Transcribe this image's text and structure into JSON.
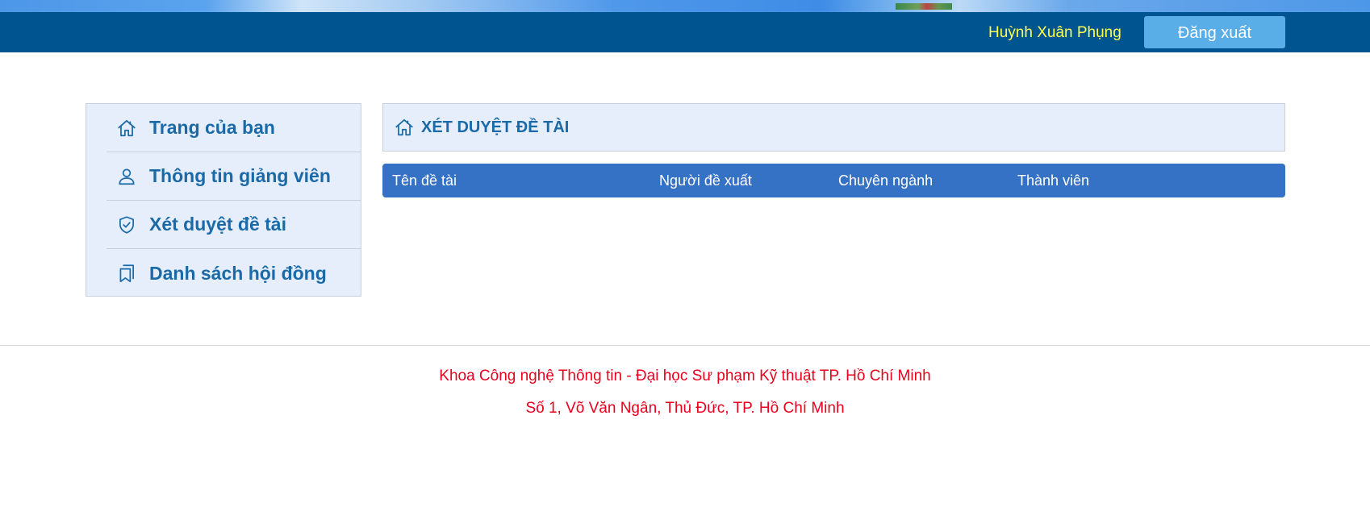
{
  "header": {
    "user_name": "Huỳnh Xuân Phụng",
    "logout_label": "Đăng xuất"
  },
  "sidebar": {
    "items": [
      {
        "label": "Trang của bạn",
        "icon": "home-icon"
      },
      {
        "label": "Thông tin giảng viên",
        "icon": "user-icon"
      },
      {
        "label": "Xét duyệt đề tài",
        "icon": "shield-check-icon"
      },
      {
        "label": "Danh sách hội đồng",
        "icon": "bookmarks-icon"
      }
    ]
  },
  "main": {
    "title": "XÉT DUYỆT ĐỀ TÀI",
    "title_icon": "home-icon",
    "table": {
      "columns": [
        "Tên đề tài",
        "Người đề xuất",
        "Chuyên ngành",
        "Thành viên"
      ],
      "rows": []
    }
  },
  "footer": {
    "line1": "Khoa Công nghệ Thông tin - Đại học Sư phạm Kỹ thuật TP. Hồ Chí Minh",
    "line2": "Số 1, Võ Văn Ngân, Thủ Đức, TP. Hồ Chí Minh"
  },
  "colors": {
    "topbar": "#005591",
    "accent": "#1a6aa8",
    "table_header": "#3571c4",
    "user_name": "#ffff4d",
    "footer_text": "#e8001c"
  }
}
